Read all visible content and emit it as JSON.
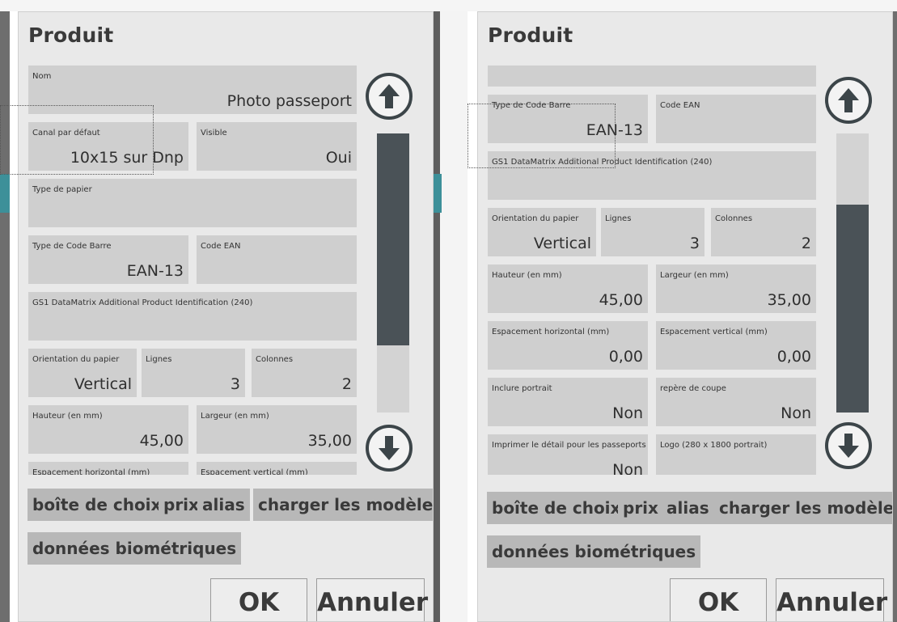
{
  "left_dialog": {
    "title": "Produit",
    "fields": {
      "nom": {
        "label": "Nom",
        "value": "Photo passeport"
      },
      "canal": {
        "label": "Canal par défaut",
        "value": "10x15 sur Dnp"
      },
      "visible": {
        "label": "Visible",
        "value": "Oui"
      },
      "type_papier": {
        "label": "Type de papier",
        "value": ""
      },
      "type_code_barre": {
        "label": "Type de Code Barre",
        "value": "EAN-13"
      },
      "code_ean": {
        "label": "Code EAN",
        "value": ""
      },
      "gs1": {
        "label": "GS1 DataMatrix Additional Product Identification (240)",
        "value": ""
      },
      "orientation": {
        "label": "Orientation du papier",
        "value": "Vertical"
      },
      "lignes": {
        "label": "Lignes",
        "value": "3"
      },
      "colonnes": {
        "label": "Colonnes",
        "value": "2"
      },
      "hauteur": {
        "label": "Hauteur (en mm)",
        "value": "45,00"
      },
      "largeur": {
        "label": "Largeur (en mm)",
        "value": "35,00"
      },
      "esp_h": {
        "label": "Espacement horizontal (mm)",
        "value": ""
      },
      "esp_v": {
        "label": "Espacement vertical (mm)",
        "value": ""
      }
    },
    "scroll_position": 0.0
  },
  "right_dialog": {
    "title": "Produit",
    "fields": {
      "type_code_barre": {
        "label": "Type de Code Barre",
        "value": "EAN-13"
      },
      "code_ean": {
        "label": "Code EAN",
        "value": ""
      },
      "gs1": {
        "label": "GS1 DataMatrix Additional Product Identification (240)",
        "value": ""
      },
      "orientation": {
        "label": "Orientation du papier",
        "value": "Vertical"
      },
      "lignes": {
        "label": "Lignes",
        "value": "3"
      },
      "colonnes": {
        "label": "Colonnes",
        "value": "2"
      },
      "hauteur": {
        "label": "Hauteur (en mm)",
        "value": "45,00"
      },
      "largeur": {
        "label": "Largeur (en mm)",
        "value": "35,00"
      },
      "esp_h": {
        "label": "Espacement horizontal (mm)",
        "value": "0,00"
      },
      "esp_v": {
        "label": "Espacement vertical (mm)",
        "value": "0,00"
      },
      "portrait": {
        "label": "Inclure portrait",
        "value": "Non"
      },
      "repere": {
        "label": "repère de coupe",
        "value": "Non"
      },
      "detail": {
        "label": "Imprimer le détail pour les passeports",
        "value": "Non"
      },
      "logo": {
        "label": "Logo (280 x 1800 portrait)",
        "value": ""
      }
    },
    "scroll_position": 0.5
  },
  "buttons": {
    "boite": "boîte de choix",
    "prix": "prix",
    "alias": "alias",
    "charger": "charger les modèles",
    "biometrie": "données biométriques",
    "ok": "OK",
    "annuler": "Annuler"
  },
  "icons": {
    "up": "arrow-up-circle-icon",
    "down": "arrow-down-circle-icon"
  },
  "colors": {
    "dialog_bg": "#e9e9e9",
    "field_bg": "#cfcfcf",
    "chip_bg": "#b8b8b8",
    "accent_teal": "#3d9099",
    "scroll_thumb": "#4a5257"
  }
}
